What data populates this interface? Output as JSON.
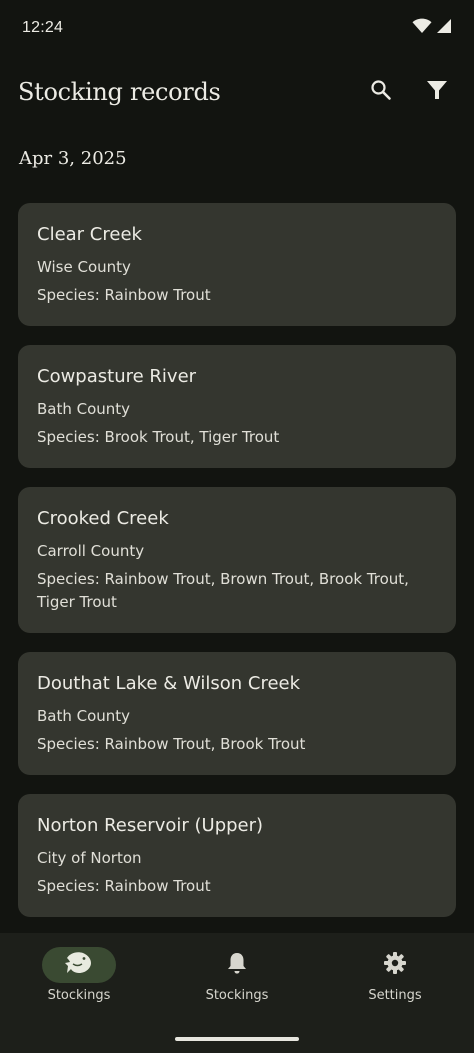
{
  "status_bar": {
    "time": "12:24",
    "icons": [
      "wifi-icon",
      "signal-icon"
    ]
  },
  "app_bar": {
    "title": "Stocking records",
    "actions": [
      {
        "icon": "search-icon"
      },
      {
        "icon": "filter-icon"
      }
    ]
  },
  "section": {
    "date": "Apr 3, 2025"
  },
  "records": [
    {
      "name": "Clear Creek",
      "county": "Wise County",
      "species": "Species: Rainbow Trout"
    },
    {
      "name": "Cowpasture River",
      "county": "Bath County",
      "species": "Species: Brook Trout, Tiger Trout"
    },
    {
      "name": "Crooked Creek",
      "county": "Carroll County",
      "species": "Species: Rainbow Trout, Brown Trout, Brook Trout, Tiger Trout"
    },
    {
      "name": "Douthat Lake & Wilson Creek",
      "county": "Bath County",
      "species": "Species: Rainbow Trout, Brook Trout"
    },
    {
      "name": "Norton Reservoir (Upper)",
      "county": "City of Norton",
      "species": "Species: Rainbow Trout"
    }
  ],
  "bottom_nav": {
    "items": [
      {
        "label": "Stockings",
        "icon": "fish-icon",
        "active": true
      },
      {
        "label": "Stockings",
        "icon": "bell-icon",
        "active": false
      },
      {
        "label": "Settings",
        "icon": "gear-icon",
        "active": false
      }
    ]
  },
  "colors": {
    "background": "#121410",
    "card": "#34362f",
    "nav_background": "#1d1f1a",
    "active_pill": "#3a4a32",
    "text": "#ecebe4"
  }
}
